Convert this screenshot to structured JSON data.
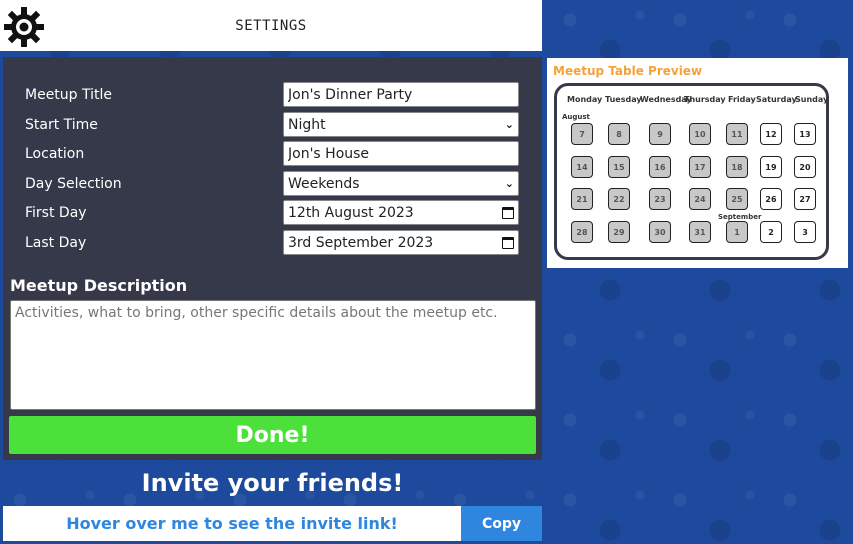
{
  "header": {
    "title": "SETTINGS",
    "icon": "gear-icon"
  },
  "settings": {
    "rows": [
      {
        "label": "Meetup Title",
        "value": "Jon's Dinner Party",
        "kind": "text"
      },
      {
        "label": "Start Time",
        "value": "Night",
        "kind": "select"
      },
      {
        "label": "Location",
        "value": "Jon's House",
        "kind": "text"
      },
      {
        "label": "Day Selection",
        "value": "Weekends",
        "kind": "select"
      },
      {
        "label": "First Day",
        "value": "12th August 2023",
        "kind": "date"
      },
      {
        "label": "Last Day",
        "value": "3rd September 2023",
        "kind": "date"
      }
    ],
    "description_heading": "Meetup Description",
    "description_placeholder": "Activities, what to bring, other specific details about the meetup etc.",
    "done_label": "Done!"
  },
  "invite": {
    "heading": "Invite your friends!",
    "link_text": "Hover over me to see the invite link!",
    "copy_label": "Copy"
  },
  "preview": {
    "title": "Meetup Table Preview",
    "days": [
      "Monday",
      "Tuesday",
      "Wednesday",
      "Thursday",
      "Friday",
      "Saturday",
      "Sunday"
    ],
    "month_labels": [
      "August",
      "September"
    ],
    "weeks": [
      [
        {
          "d": "7",
          "active": false
        },
        {
          "d": "8",
          "active": false
        },
        {
          "d": "9",
          "active": false
        },
        {
          "d": "10",
          "active": false
        },
        {
          "d": "11",
          "active": false
        },
        {
          "d": "12",
          "active": true
        },
        {
          "d": "13",
          "active": true
        }
      ],
      [
        {
          "d": "14",
          "active": false
        },
        {
          "d": "15",
          "active": false
        },
        {
          "d": "16",
          "active": false
        },
        {
          "d": "17",
          "active": false
        },
        {
          "d": "18",
          "active": false
        },
        {
          "d": "19",
          "active": true
        },
        {
          "d": "20",
          "active": true
        }
      ],
      [
        {
          "d": "21",
          "active": false
        },
        {
          "d": "22",
          "active": false
        },
        {
          "d": "23",
          "active": false
        },
        {
          "d": "24",
          "active": false
        },
        {
          "d": "25",
          "active": false
        },
        {
          "d": "26",
          "active": true
        },
        {
          "d": "27",
          "active": true
        }
      ],
      [
        {
          "d": "28",
          "active": false
        },
        {
          "d": "29",
          "active": false
        },
        {
          "d": "30",
          "active": false
        },
        {
          "d": "31",
          "active": false
        },
        {
          "d": "1",
          "active": false
        },
        {
          "d": "2",
          "active": true
        },
        {
          "d": "3",
          "active": true
        }
      ]
    ]
  },
  "colors": {
    "background": "#1d4a9c",
    "panel": "#363949",
    "done": "#4be03a",
    "accent": "#2e86de",
    "preview_title": "#f4a23a"
  }
}
